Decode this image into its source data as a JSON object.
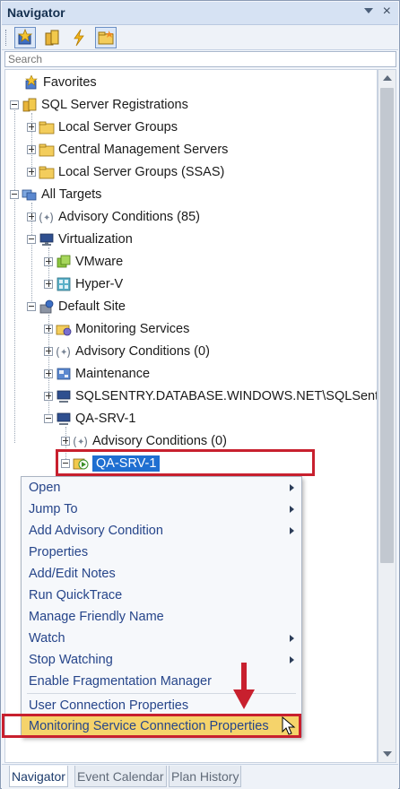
{
  "window": {
    "title": "Navigator",
    "close_glyph": "×",
    "search_placeholder": "Search"
  },
  "toolbar": {
    "buttons": [
      "favorites-tool-icon",
      "registrations-tool-icon",
      "lightning-tool-icon",
      "folder-tool-icon"
    ]
  },
  "tree": {
    "favorites": "Favorites",
    "sql_server_registrations": "SQL Server Registrations",
    "local_server_groups": "Local Server Groups",
    "central_management_servers": "Central Management Servers",
    "local_server_groups_ssas": "Local Server Groups (SSAS)",
    "all_targets": "All Targets",
    "advisory_conditions_85": "Advisory Conditions (85)",
    "virtualization": "Virtualization",
    "vmware": "VMware",
    "hyper_v": "Hyper-V",
    "default_site": "Default Site",
    "monitoring_services": "Monitoring Services",
    "advisory_conditions_0_site": "Advisory Conditions (0)",
    "maintenance": "Maintenance",
    "sqlsentry_database": "SQLSENTRY.DATABASE.WINDOWS.NET\\SQLSentry",
    "qa_srv_1_server": "QA-SRV-1",
    "advisory_conditions_0_server": "Advisory Conditions (0)",
    "qa_srv_1_selected": "QA-SRV-1"
  },
  "context_menu": {
    "open": "Open",
    "jump_to": "Jump To",
    "add_advisory_condition": "Add Advisory Condition",
    "properties": "Properties",
    "add_edit_notes": "Add/Edit Notes",
    "run_quicktrace": "Run QuickTrace",
    "manage_friendly_name": "Manage Friendly Name",
    "watch": "Watch",
    "stop_watching": "Stop Watching",
    "enable_fragmentation_manager": "Enable Fragmentation Manager",
    "user_connection_properties": "User Connection Properties",
    "monitoring_service_connection_properties": "Monitoring Service Connection Properties"
  },
  "tabs": {
    "navigator": "Navigator",
    "event_calendar": "Event Calendar",
    "plan_history": "Plan History"
  },
  "colors": {
    "highlight_box": "#c8202e",
    "selection": "#1f6fd1",
    "menu_hover": "#f5d36b"
  }
}
